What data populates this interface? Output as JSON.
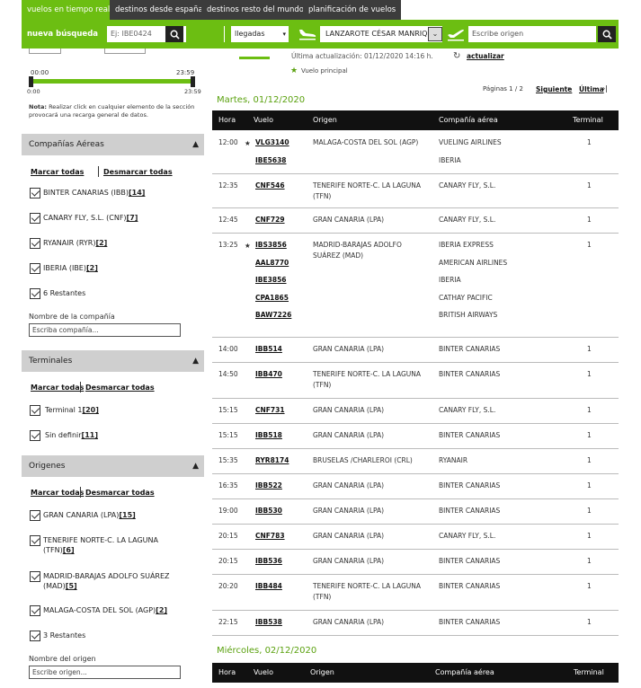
{
  "tabs": [
    {
      "label": "vuelos en tiempo real",
      "active": true
    },
    {
      "label": "destinos desde españa",
      "active": false
    },
    {
      "label": "destinos resto del mundo",
      "active": false
    },
    {
      "label": "planificación de vuelos",
      "active": false
    }
  ],
  "search": {
    "new_search_label": "nueva búsqueda",
    "flight_placeholder": "Ej: IBE0424",
    "direction": "llegadas",
    "airport": "LANZAROTE CÉSAR MANRIQUE",
    "origin_placeholder": "Escribe origen"
  },
  "sidebar": {
    "slider": {
      "from": "00:00",
      "to": "23:59",
      "min": "0:00",
      "max": "23:59"
    },
    "note_bold": "Nota:",
    "note": " Realizar click en cualquier elemento de la sección provocará una recarga general de datos.",
    "mark_all": "Marcar todas",
    "unmark_all": "Desmarcar todas",
    "airlines": {
      "title": "Compañías Aéreas",
      "items": [
        {
          "label": "BINTER CANARIAS (IBB)",
          "count": "[14]"
        },
        {
          "label": "CANARY FLY, S.L. (CNF)",
          "count": "[7]"
        },
        {
          "label": "RYANAIR (RYR)",
          "count": "[2]"
        },
        {
          "label": "IBERIA (IBE)",
          "count": "[2]"
        },
        {
          "label": "6 Restantes",
          "count": ""
        }
      ],
      "field_label": "Nombre de la compañía",
      "field_placeholder": "Escriba compañía..."
    },
    "terminals": {
      "title": "Terminales",
      "items": [
        {
          "label": "Terminal 1",
          "count": "[20]"
        },
        {
          "label": "Sin definir",
          "count": "[11]"
        }
      ]
    },
    "origins": {
      "title": "Origenes",
      "items": [
        {
          "label": "GRAN CANARIA (LPA)",
          "count": "[15]"
        },
        {
          "label": "TENERIFE NORTE-C. LA LAGUNA (TFN)",
          "count": "[6]"
        },
        {
          "label": "MADRID-BARAJAS ADOLFO SUÁREZ (MAD)",
          "count": "[5]"
        },
        {
          "label": "MALAGA-COSTA DEL SOL (AGP)",
          "count": "[2]"
        },
        {
          "label": "3 Restantes",
          "count": ""
        }
      ],
      "field_label": "Nombre del origen",
      "field_placeholder": "Escribe origen..."
    }
  },
  "main": {
    "last_update": "Última actualización: 01/12/2020 14:16 h.",
    "refresh": "actualizar",
    "legend_main": "Vuelo principal",
    "pages": "Páginas 1 / 2",
    "next": "Siguiente",
    "last": "Última",
    "columns": [
      "Hora",
      "Vuelo",
      "Origen",
      "Compañía aérea",
      "Terminal"
    ],
    "day1": "Martes, 01/12/2020",
    "day2": "Miércoles, 02/12/2020",
    "flights": [
      {
        "time": "12:00",
        "flights": [
          "VLG3140",
          "IBE5638"
        ],
        "star": true,
        "origin": "MALAGA-COSTA DEL SOL (AGP)",
        "airlines": [
          "VUELING AIRLINES",
          "IBERIA"
        ],
        "terminal": "1"
      },
      {
        "time": "12:35",
        "flights": [
          "CNF546"
        ],
        "star": false,
        "origin": "TENERIFE NORTE-C. LA LAGUNA (TFN)",
        "airlines": [
          "CANARY FLY, S.L."
        ],
        "terminal": "1"
      },
      {
        "time": "12:45",
        "flights": [
          "CNF729"
        ],
        "star": false,
        "origin": "GRAN CANARIA (LPA)",
        "airlines": [
          "CANARY FLY, S.L."
        ],
        "terminal": "1"
      },
      {
        "time": "13:25",
        "flights": [
          "IBS3856",
          "AAL8770",
          "IBE3856",
          "CPA1865",
          "BAW7226"
        ],
        "star": true,
        "origin": "MADRID-BARAJAS ADOLFO SUÁREZ (MAD)",
        "airlines": [
          "IBERIA EXPRESS",
          "AMERICAN AIRLINES",
          "IBERIA",
          "CATHAY PACIFIC",
          "BRITISH AIRWAYS"
        ],
        "terminal": "1"
      },
      {
        "time": "14:00",
        "flights": [
          "IBB514"
        ],
        "star": false,
        "origin": "GRAN CANARIA (LPA)",
        "airlines": [
          "BINTER CANARIAS"
        ],
        "terminal": "1"
      },
      {
        "time": "14:50",
        "flights": [
          "IBB470"
        ],
        "star": false,
        "origin": "TENERIFE NORTE-C. LA LAGUNA (TFN)",
        "airlines": [
          "BINTER CANARIAS"
        ],
        "terminal": "1"
      },
      {
        "time": "15:15",
        "flights": [
          "CNF731"
        ],
        "star": false,
        "origin": "GRAN CANARIA (LPA)",
        "airlines": [
          "CANARY FLY, S.L."
        ],
        "terminal": "1"
      },
      {
        "time": "15:15",
        "flights": [
          "IBB518"
        ],
        "star": false,
        "origin": "GRAN CANARIA (LPA)",
        "airlines": [
          "BINTER CANARIAS"
        ],
        "terminal": "1"
      },
      {
        "time": "15:35",
        "flights": [
          "RYR8174"
        ],
        "star": false,
        "origin": "BRUSELAS /CHARLEROI (CRL)",
        "airlines": [
          "RYANAIR"
        ],
        "terminal": "1"
      },
      {
        "time": "16:35",
        "flights": [
          "IBB522"
        ],
        "star": false,
        "origin": "GRAN CANARIA (LPA)",
        "airlines": [
          "BINTER CANARIAS"
        ],
        "terminal": "1"
      },
      {
        "time": "19:00",
        "flights": [
          "IBB530"
        ],
        "star": false,
        "origin": "GRAN CANARIA (LPA)",
        "airlines": [
          "BINTER CANARIAS"
        ],
        "terminal": "1"
      },
      {
        "time": "20:15",
        "flights": [
          "CNF783"
        ],
        "star": false,
        "origin": "GRAN CANARIA (LPA)",
        "airlines": [
          "CANARY FLY, S.L."
        ],
        "terminal": "1"
      },
      {
        "time": "20:15",
        "flights": [
          "IBB536"
        ],
        "star": false,
        "origin": "GRAN CANARIA (LPA)",
        "airlines": [
          "BINTER CANARIAS"
        ],
        "terminal": "1"
      },
      {
        "time": "20:20",
        "flights": [
          "IBB484"
        ],
        "star": false,
        "origin": "TENERIFE NORTE-C. LA LAGUNA (TFN)",
        "airlines": [
          "BINTER CANARIAS"
        ],
        "terminal": "1"
      },
      {
        "time": "22:15",
        "flights": [
          "IBB538"
        ],
        "star": false,
        "origin": "GRAN CANARIA (LPA)",
        "airlines": [
          "BINTER CANARIAS"
        ],
        "terminal": "1"
      }
    ]
  },
  "colors": {
    "accent": "#6cbe12",
    "dark": "#111111",
    "tab": "#3c3c3c",
    "section": "#cfcfcf"
  }
}
